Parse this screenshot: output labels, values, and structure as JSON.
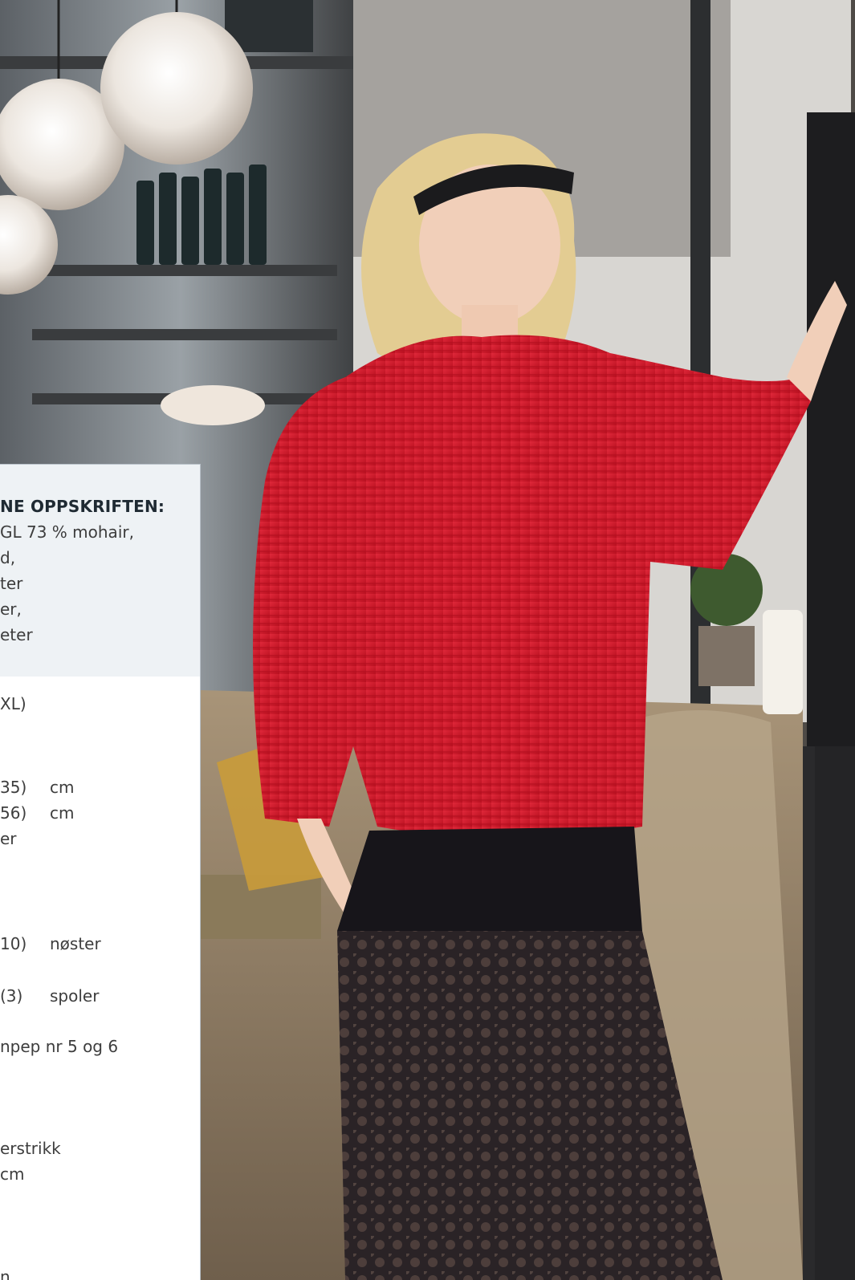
{
  "photo": {
    "alt_subject": "model-in-red-mohair-sweater"
  },
  "info_panel": {
    "title": "NE OPPSKRIFTEN:",
    "yarn_lines": [
      "GL 73 % mohair,",
      "d,",
      "ter",
      "er,",
      "eter"
    ],
    "size_line": "XL)",
    "measurements": [
      {
        "value": "35)",
        "unit": "cm"
      },
      {
        "value": "56)",
        "unit": "cm"
      }
    ],
    "measure_note": "er",
    "amounts": [
      {
        "value": "10)",
        "unit": "nøster"
      },
      {
        "value": "(3)",
        "unit": "spoler"
      }
    ],
    "needles": "npep nr 5 og 6",
    "gauge_lines": [
      "erstrikk",
      "cm"
    ],
    "bottom_fragment": "n"
  },
  "colors": {
    "panel_bg": "#ffffff",
    "panel_head_bg": "#eef2f5",
    "panel_border": "#b9c2ca",
    "sweater_red": "#d41a2c",
    "text": "#3d3d3d"
  }
}
